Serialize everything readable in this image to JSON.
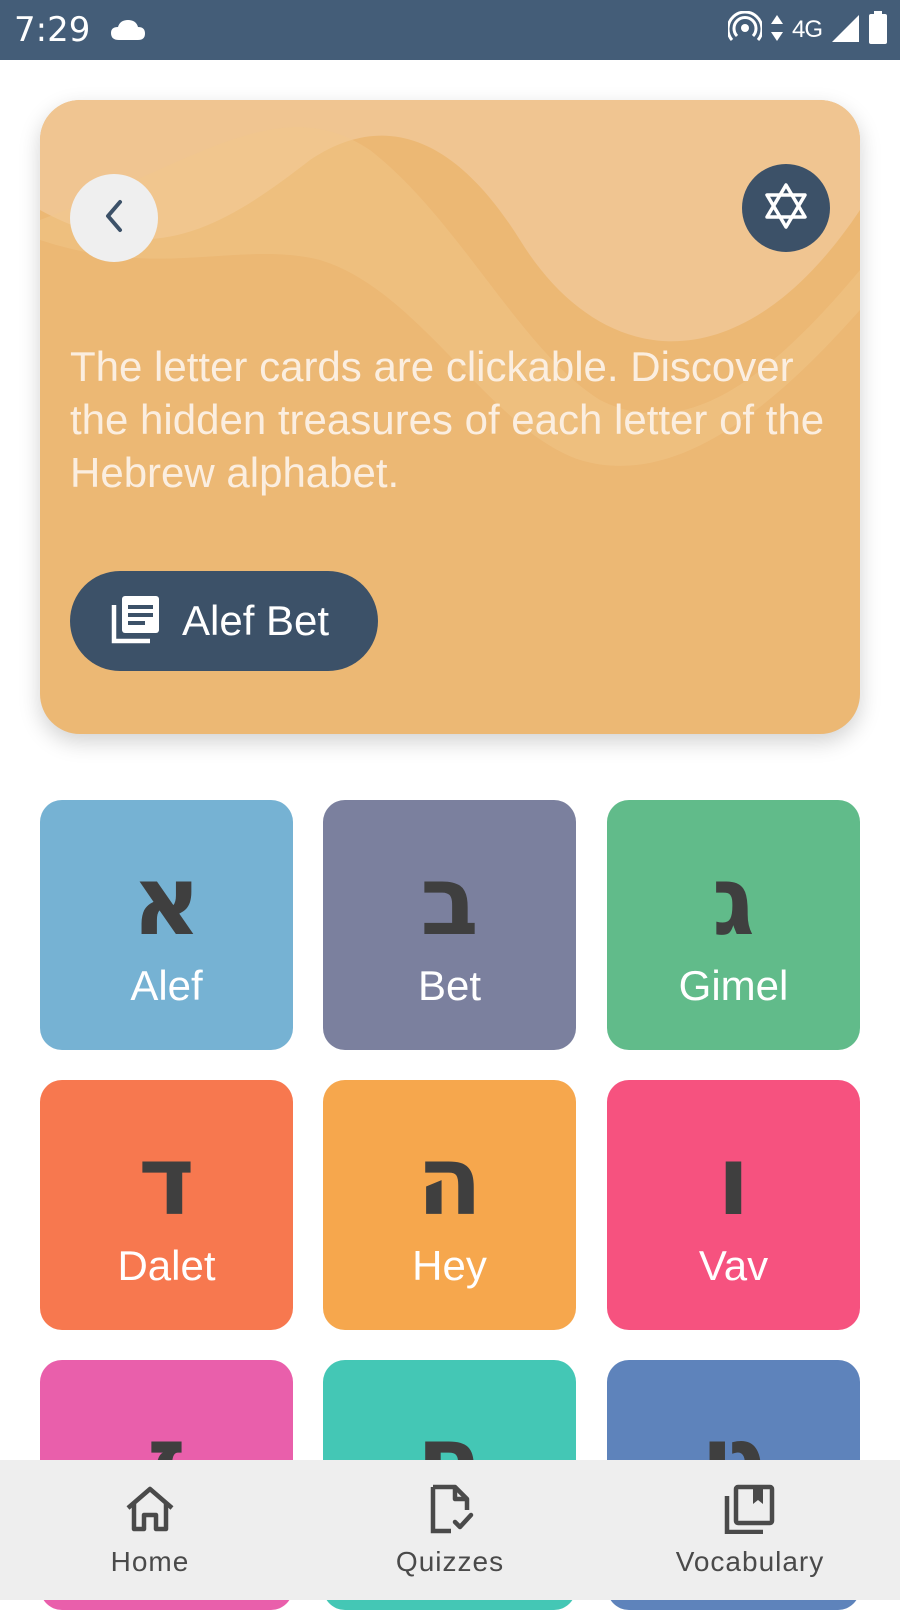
{
  "status_bar": {
    "time": "7:29",
    "network": "4G",
    "icons": [
      "cloud-icon",
      "hotspot-icon",
      "data-arrows-icon",
      "signal-icon",
      "battery-icon"
    ]
  },
  "hero": {
    "description": "The letter cards are clickable. Discover the hidden treasures of each letter of the Hebrew alphabet.",
    "button_label": "Alef Bet",
    "icons": [
      "back-chevron-icon",
      "star-of-david-icon",
      "library-books-icon"
    ],
    "background_color": "#ecb874",
    "accent_color": "#3c5168"
  },
  "letters": [
    {
      "glyph": "א",
      "name": "Alef",
      "color": "#76b2d3"
    },
    {
      "glyph": "ב",
      "name": "Bet",
      "color": "#7b809e"
    },
    {
      "glyph": "ג",
      "name": "Gimel",
      "color": "#61bb8a"
    },
    {
      "glyph": "ד",
      "name": "Dalet",
      "color": "#f7784f"
    },
    {
      "glyph": "ה",
      "name": "Hey",
      "color": "#f6a74d"
    },
    {
      "glyph": "ו",
      "name": "Vav",
      "color": "#f6527f"
    },
    {
      "glyph": "ז",
      "name": "",
      "color": "#e95fab"
    },
    {
      "glyph": "ח",
      "name": "",
      "color": "#44c7b5"
    },
    {
      "glyph": "ט",
      "name": "",
      "color": "#5e83bb"
    }
  ],
  "bottom_nav": {
    "items": [
      {
        "label": "Home",
        "icon": "home-icon"
      },
      {
        "label": "Quizzes",
        "icon": "quiz-icon"
      },
      {
        "label": "Vocabulary",
        "icon": "vocabulary-icon"
      }
    ]
  }
}
